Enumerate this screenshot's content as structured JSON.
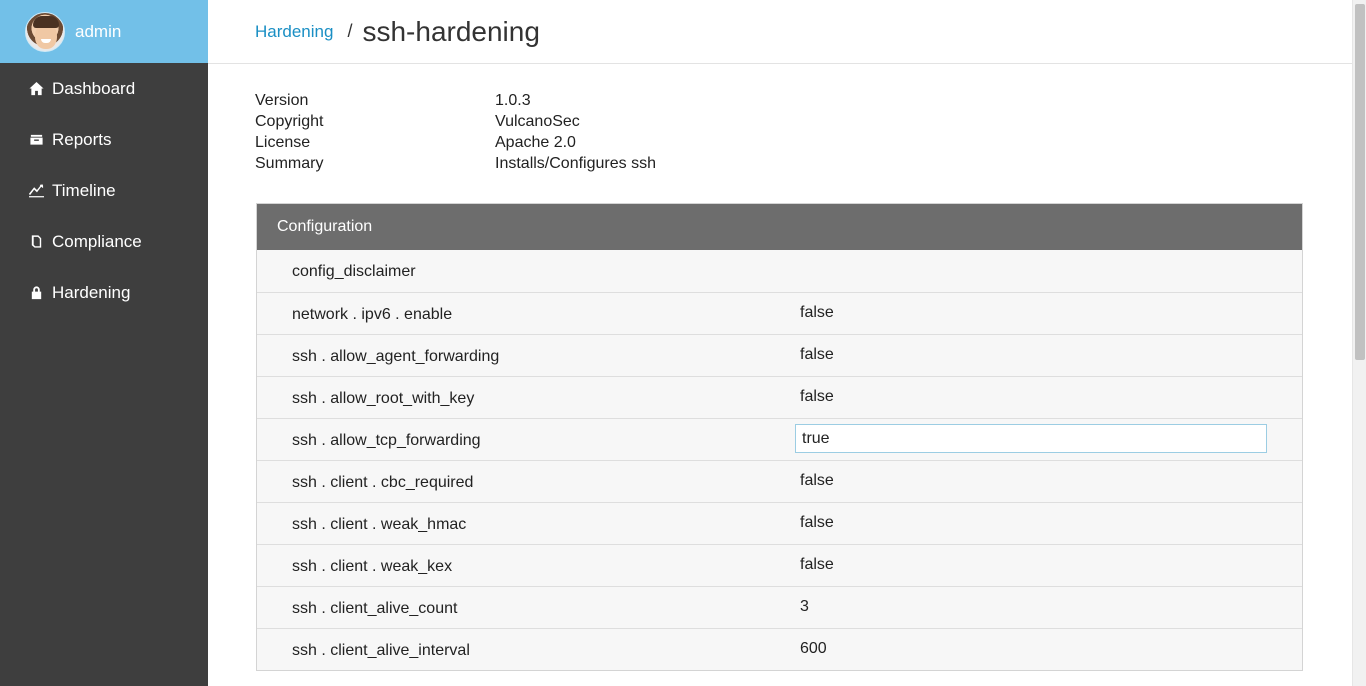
{
  "sidebar": {
    "user": "admin",
    "items": [
      {
        "label": "Dashboard",
        "icon": "home-icon"
      },
      {
        "label": "Reports",
        "icon": "inbox-icon"
      },
      {
        "label": "Timeline",
        "icon": "trend-line-icon"
      },
      {
        "label": "Compliance",
        "icon": "book-icon"
      },
      {
        "label": "Hardening",
        "icon": "lock-icon"
      }
    ]
  },
  "breadcrumb": {
    "parent": "Hardening",
    "separator": "/",
    "title": "ssh-hardening"
  },
  "info": {
    "version_label": "Version",
    "version": "1.0.3",
    "copyright_label": "Copyright",
    "copyright": "VulcanoSec",
    "license_label": "License",
    "license": "Apache 2.0",
    "summary_label": "Summary",
    "summary": "Installs/Configures ssh"
  },
  "configuration": {
    "title": "Configuration",
    "rows": [
      {
        "key": "config_disclaimer",
        "value": ""
      },
      {
        "key": "network . ipv6 . enable",
        "value": "false"
      },
      {
        "key": "ssh . allow_agent_forwarding",
        "value": "false"
      },
      {
        "key": "ssh . allow_root_with_key",
        "value": "false"
      },
      {
        "key": "ssh . allow_tcp_forwarding",
        "value": "true"
      },
      {
        "key": "ssh . client . cbc_required",
        "value": "false"
      },
      {
        "key": "ssh . client . weak_hmac",
        "value": "false"
      },
      {
        "key": "ssh . client . weak_kex",
        "value": "false"
      },
      {
        "key": "ssh . client_alive_count",
        "value": "3"
      },
      {
        "key": "ssh . client_alive_interval",
        "value": "600"
      }
    ]
  },
  "colors": {
    "sidebar_bg": "#3e3e3e",
    "sidebar_header": "#72c0e8",
    "link": "#1a8fc4",
    "panel_header": "#6d6d6d"
  }
}
